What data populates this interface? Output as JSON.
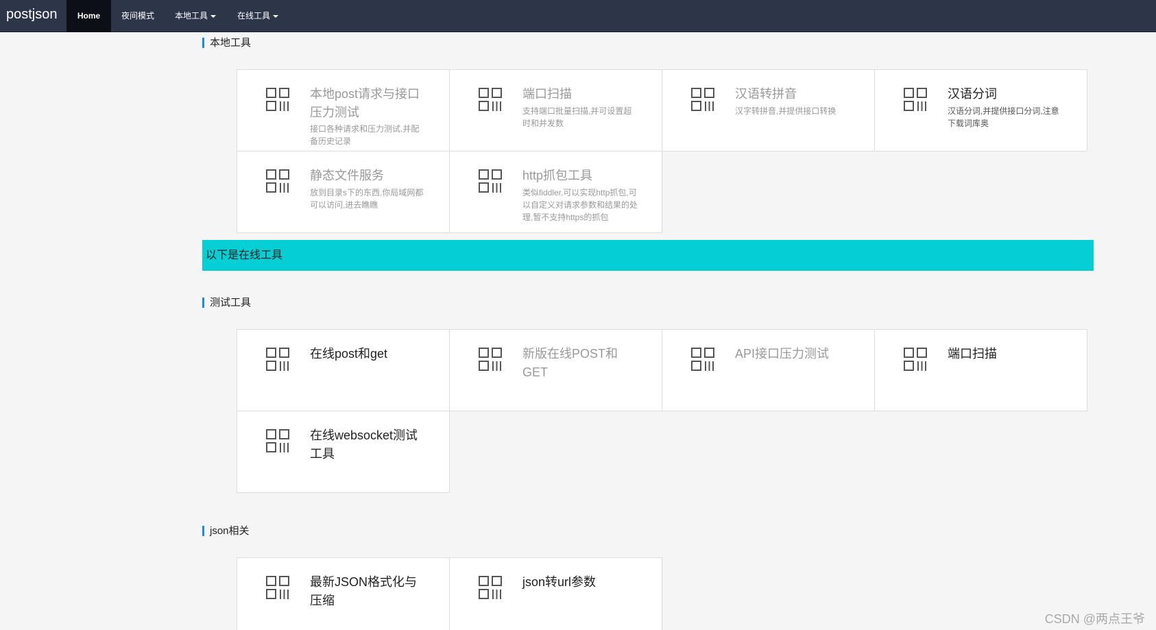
{
  "navbar": {
    "brand": "postjson",
    "items": [
      {
        "label": "Home"
      },
      {
        "label": "夜间模式"
      },
      {
        "label": "本地工具"
      },
      {
        "label": "在线工具"
      }
    ]
  },
  "sections": {
    "local": {
      "title": "本地工具",
      "cards": [
        {
          "title": "本地post请求与接口压力测试",
          "desc": "接口各种请求和压力测试,并配备历史记录"
        },
        {
          "title": "端口扫描",
          "desc": "支持端口批量扫描,并可设置超时和并发数"
        },
        {
          "title": "汉语转拼音",
          "desc": "汉字转拼音,并提供接口转换"
        },
        {
          "title": "汉语分词",
          "desc": "汉语分词,并提供接口分词,注意下载词库奥"
        },
        {
          "title": "静态文件服务",
          "desc": "放到目录s下的东西,你局域网都可以访问,进去瞧瞧"
        },
        {
          "title": "http抓包工具",
          "desc": "类似fiddler,可以实现http抓包,可以自定义对请求参数和结果的处理,暂不支持https的抓包"
        }
      ]
    },
    "banner": "以下是在线工具",
    "test": {
      "title": "测试工具",
      "cards": [
        {
          "title": "在线post和get"
        },
        {
          "title": "新版在线POST和GET"
        },
        {
          "title": "API接口压力测试"
        },
        {
          "title": "端口扫描"
        },
        {
          "title": "在线websocket测试工具"
        }
      ]
    },
    "json": {
      "title": "json相关",
      "cards": [
        {
          "title": "最新JSON格式化与压缩"
        },
        {
          "title": "json转url参数"
        }
      ]
    }
  },
  "watermark": "CSDN @两点王爷"
}
